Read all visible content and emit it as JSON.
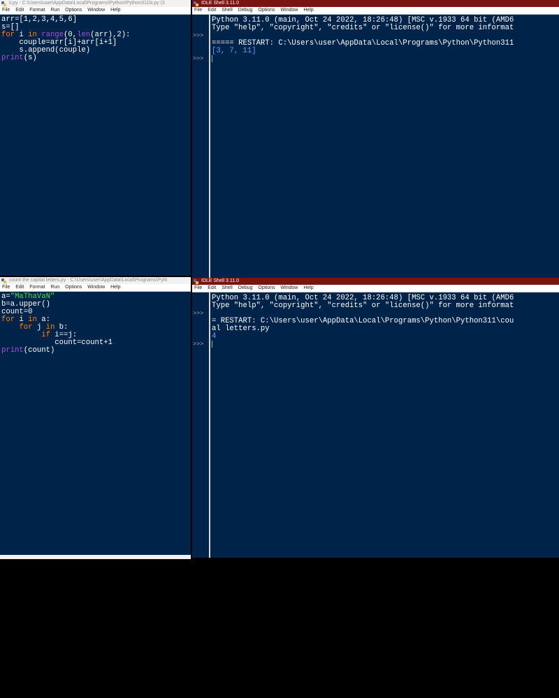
{
  "editor1": {
    "title": "ii.py - C:\\Users\\user\\AppData\\Local\\Programs\\Python\\Python311\\ii.py (3",
    "menu": [
      "File",
      "Edit",
      "Format",
      "Run",
      "Options",
      "Window",
      "Help"
    ],
    "code": {
      "l1": "arr=[1,2,3,4,5,6]",
      "l2": "s=[]",
      "l3_kw_for": "for",
      "l3_a": " i ",
      "l3_kw_in": "in",
      "l3_b": " ",
      "l3_range": "range",
      "l3_c": "(0,",
      "l3_len": "len",
      "l3_d": "(arr),2):",
      "l4": "    couple=arr[i]+arr[i+1]",
      "l5": "    s.append(couple)",
      "l6_print": "print",
      "l6_rest": "(s)"
    }
  },
  "shell1": {
    "title": "IDLE Shell 3.11.0",
    "menu": [
      "File",
      "Edit",
      "Shell",
      "Debug",
      "Options",
      "Window",
      "Help"
    ],
    "prompt": ">>>",
    "lines": {
      "l1": "Python 3.11.0 (main, Oct 24 2022, 18:26:48) [MSC v.1933 64 bit (AMD6",
      "l2": "Type \"help\", \"copyright\", \"credits\" or \"license()\" for more informat",
      "l3": "===== RESTART: C:\\Users\\user\\AppData\\Local\\Programs\\Python\\Python311",
      "out": "[3, 7, 11]"
    }
  },
  "editor2": {
    "title": "count the capital letters.py - C:\\Users\\user\\AppData\\Local\\Programs\\Pyth",
    "menu": [
      "File",
      "Edit",
      "Format",
      "Run",
      "Options",
      "Window",
      "Help"
    ],
    "code": {
      "l1_a": "a=",
      "l1_str": "\"MaThaVaN\"",
      "l2": "b=a.upper()",
      "l3": "count=0",
      "l4_for": "for",
      "l4_a": " i ",
      "l4_in": "in",
      "l4_b": " a:",
      "l5_sp": "    ",
      "l5_for": "for",
      "l5_a": " j ",
      "l5_in": "in",
      "l5_b": " b:",
      "l6_sp": "         ",
      "l6_if": "if",
      "l6_rest": " i==j:",
      "l7": "            count=count+1",
      "l8_print": "print",
      "l8_rest": "(count)"
    }
  },
  "shell2": {
    "title": "IDLE Shell 3.11.0",
    "menu": [
      "File",
      "Edit",
      "Shell",
      "Debug",
      "Options",
      "Window",
      "Help"
    ],
    "prompt": ">>>",
    "lines": {
      "l1": "Python 3.11.0 (main, Oct 24 2022, 18:26:48) [MSC v.1933 64 bit (AMD6",
      "l2": "Type \"help\", \"copyright\", \"credits\" or \"license()\" for more informat",
      "l3": "= RESTART: C:\\Users\\user\\AppData\\Local\\Programs\\Python\\Python311\\cou",
      "l4": "al letters.py",
      "out": "4"
    }
  }
}
